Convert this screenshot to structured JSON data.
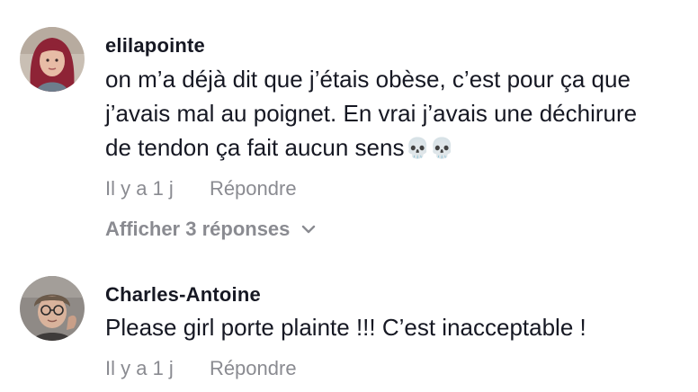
{
  "comments": [
    {
      "username": "elilapointe",
      "lines": [
        "on m’a déjà dit que j’étais obèse, c’est pour ça que",
        "j’avais mal au poignet. En vrai j’avais une déchirure",
        "de tendon ça fait aucun sens"
      ],
      "emoji": "💀💀",
      "timestamp": "Il y a 1 j",
      "reply_label": "Répondre",
      "replies_label": "Afficher 3 réponses",
      "avatar_icon": "profile-photo-red-hair",
      "colors": {
        "hair": "#8e2336",
        "skin": "#e7bca6",
        "bg": "#c9bfb4"
      }
    },
    {
      "username": "Charles-Antoine",
      "lines": [
        "Please girl porte plainte !!! C’est inacceptable !"
      ],
      "timestamp": "Il y a 1 j",
      "reply_label": "Répondre",
      "avatar_icon": "profile-photo-glasses",
      "colors": {
        "hair": "#6b5a4a",
        "skin": "#d9b39c",
        "bg": "#8f8a86"
      }
    }
  ],
  "colors": {
    "primary_text": "#161823",
    "secondary_text": "#8a8b91",
    "background": "#ffffff"
  }
}
